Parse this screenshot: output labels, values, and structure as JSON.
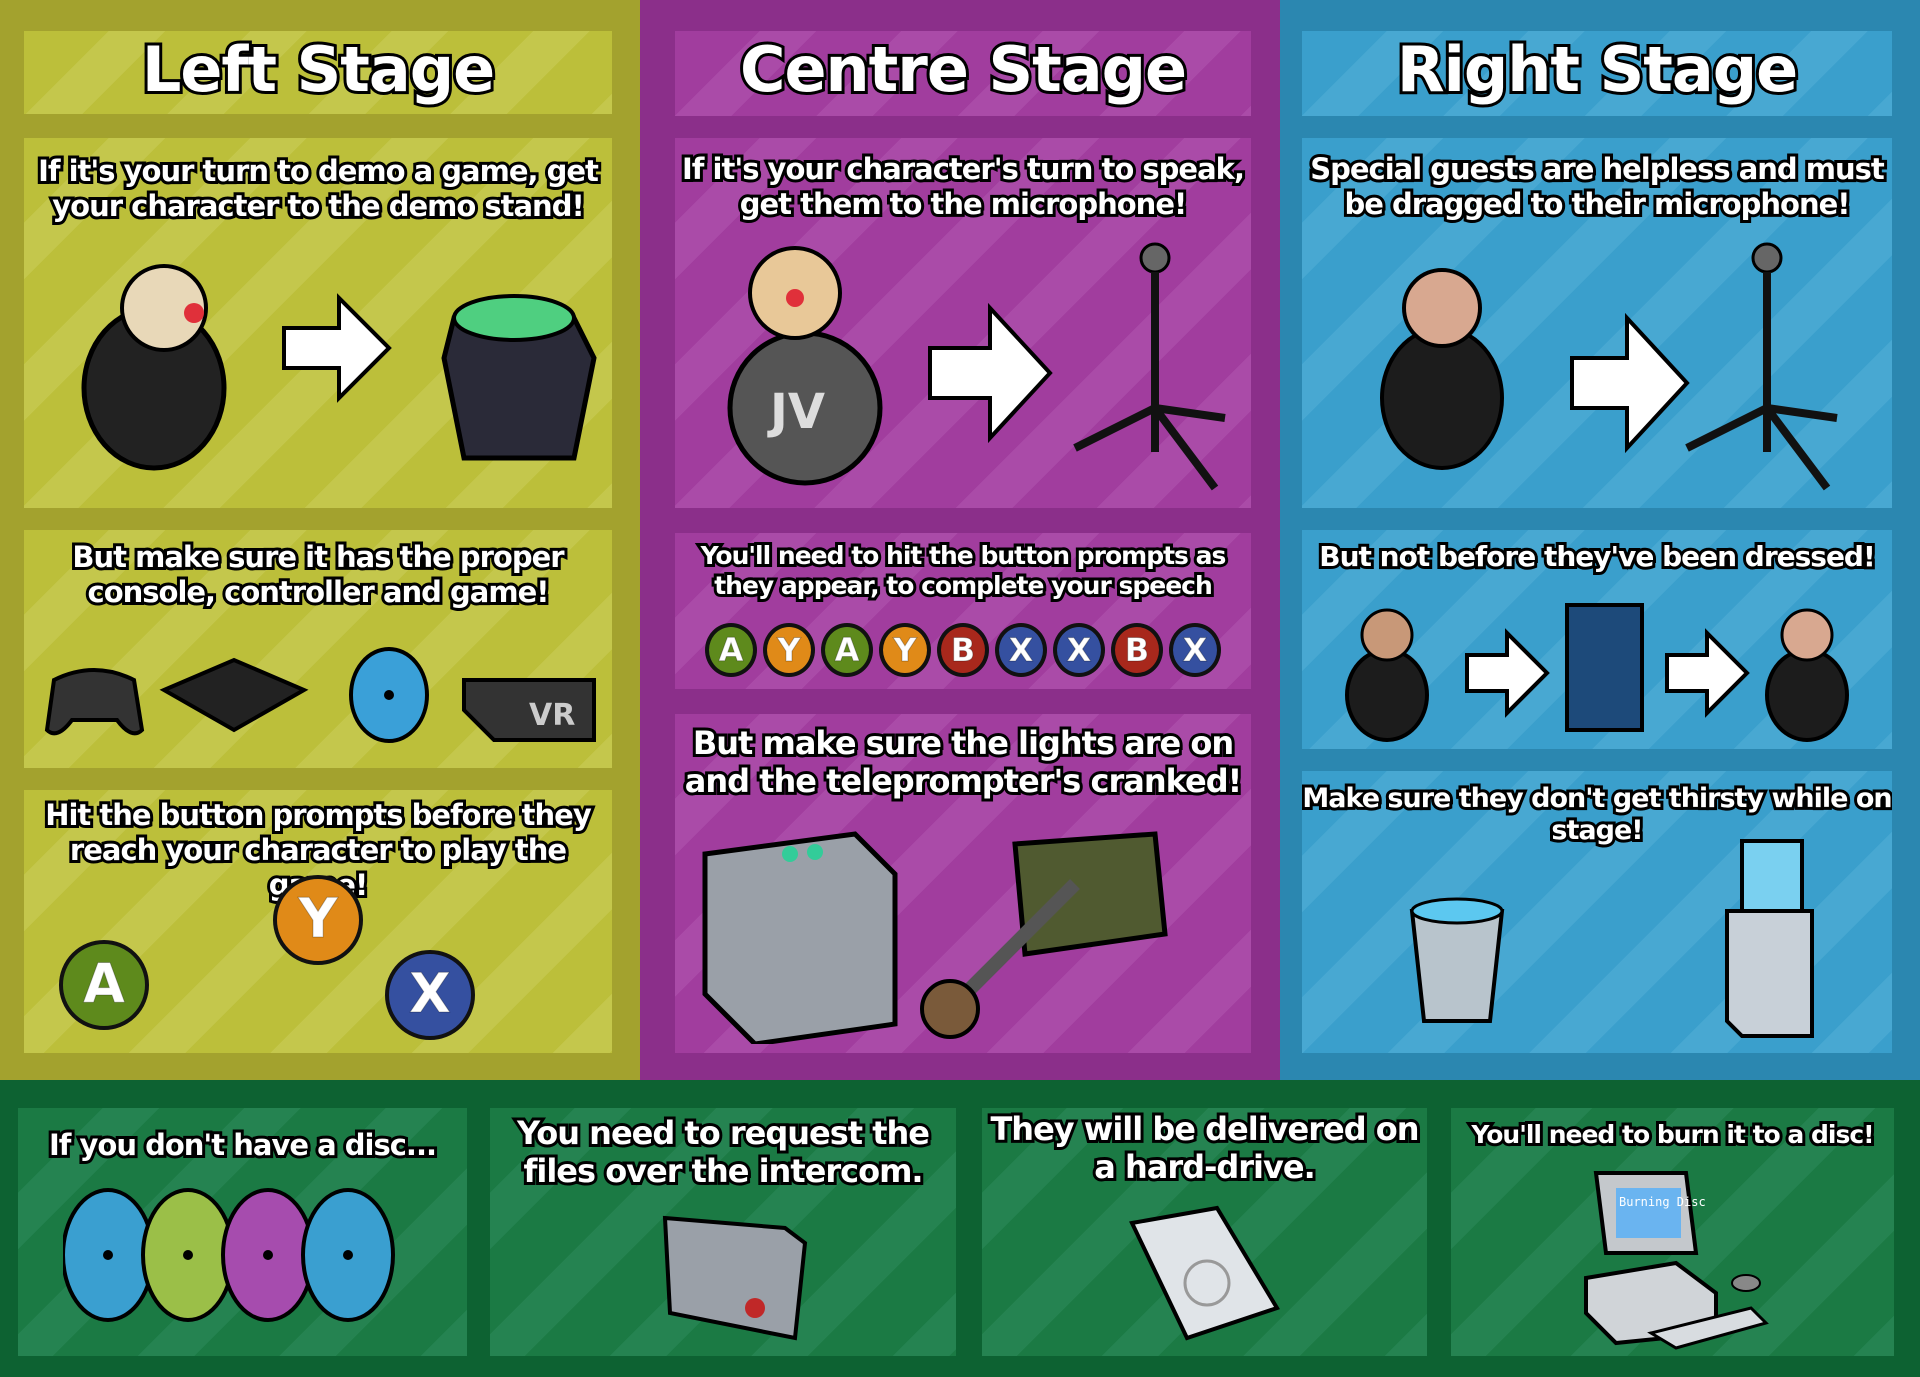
{
  "left": {
    "title": "Left Stage",
    "panel1": "If it's your turn to demo a game, get your character to the demo stand!",
    "panel2": "But make sure it has the proper console, controller and game!",
    "vr_label": "VR",
    "panel3": "Hit the button prompts before they reach your character to play the game!",
    "prompts": [
      {
        "letter": "A",
        "color": "#5e8a1c"
      },
      {
        "letter": "Y",
        "color": "#e08a18"
      },
      {
        "letter": "X",
        "color": "#3550a0"
      }
    ]
  },
  "centre": {
    "title": "Centre Stage",
    "panel1": "If it's your character's turn to speak, get them to the microphone!",
    "character_label": "JV",
    "panel2": "You'll need to hit the button prompts as they appear, to complete your speech",
    "prompts": [
      {
        "letter": "A",
        "color": "#5e8a1c"
      },
      {
        "letter": "Y",
        "color": "#e08a18"
      },
      {
        "letter": "A",
        "color": "#5e8a1c"
      },
      {
        "letter": "Y",
        "color": "#e08a18"
      },
      {
        "letter": "B",
        "color": "#a8281c"
      },
      {
        "letter": "X",
        "color": "#3550a0"
      },
      {
        "letter": "X",
        "color": "#3550a0"
      },
      {
        "letter": "B",
        "color": "#a8281c"
      },
      {
        "letter": "X",
        "color": "#3550a0"
      }
    ],
    "panel3": "But make sure the lights are on and the teleprompter's cranked!"
  },
  "right": {
    "title": "Right Stage",
    "panel1": "Special guests are helpless and must be dragged to their microphone!",
    "panel2": "But not before they've been dressed!",
    "panel3": "Make sure they don't get thirsty while on stage!"
  },
  "bottom": {
    "panel1": "If you don't have a disc...",
    "panel2": "You need to request the files over the intercom.",
    "panel3": "They will be delivered on a hard-drive.",
    "panel4": "You'll need to burn it to a disc!",
    "screen_text": "Burning Disc",
    "disc_colors": [
      "#3a9fd0",
      "#9bbf48",
      "#a64cae",
      "#3a9fd0"
    ]
  }
}
